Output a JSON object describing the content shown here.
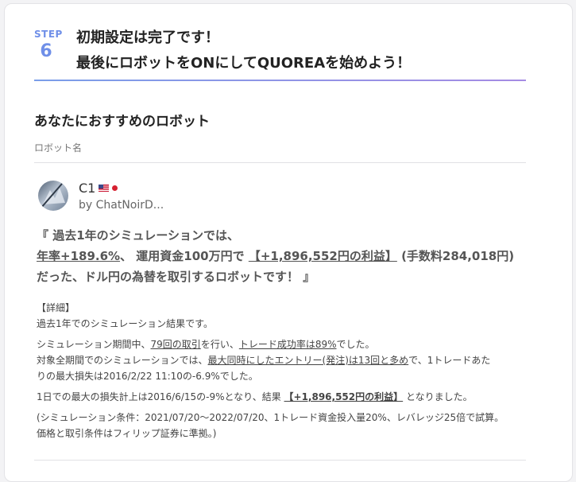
{
  "step": {
    "label": "STEP",
    "number": "6",
    "title_line1": "初期設定は完了です！",
    "title_line2": "最後にロボットをONにしてQUOREAを始めよう！"
  },
  "section": {
    "title": "あなたにおすすめのロボット",
    "column_header": "ロボット名"
  },
  "robot": {
    "name": "C1",
    "flags": [
      "us-flag-icon",
      "jp-flag-icon"
    ],
    "author": "by ChatNoirD..."
  },
  "summary": {
    "l1": "『 過去1年のシミュレーションでは、",
    "l2_a": "年率+189.6%",
    "l2_b": "、 運用資金100万円で ",
    "l2_c": "【+1,896,552円の利益】",
    "l2_d": " (手数料284,018円)",
    "l3": "だった、ドル円の為替を取引するロボットです！ 』"
  },
  "detail": {
    "heading": "【詳細】",
    "l1": "過去1年でのシミュレーション結果です。",
    "l2_a": "シミュレーション期間中、",
    "l2_b": "79回の取引",
    "l2_c": "を行い、",
    "l2_d": "トレード成功率は89%",
    "l2_e": "でした。",
    "l3_a": "対象全期間でのシミュレーションでは、",
    "l3_b": "最大同時にしたエントリー(発注)は13回と多め",
    "l3_c": "で、1トレードあた",
    "l4": "りの最大損失は2016/2/22 11:10の-6.9%でした。",
    "l5_a": "1日での最大の損失計上は2016/6/15の-9%となり、結果 ",
    "l5_b": "【+1,896,552円の利益】",
    "l5_c": " となりました。",
    "l6": "(シミュレーション条件：2021/07/20〜2022/07/20、1トレード資金投入量20%、レバレッジ25倍で試算。",
    "l7": "価格と取引条件はフィリップ証券に準拠。)"
  },
  "colors": {
    "step_accent": "#6f8fe8",
    "rule_gradient_start": "#7a9ee9",
    "rule_gradient_end": "#a58be3"
  }
}
